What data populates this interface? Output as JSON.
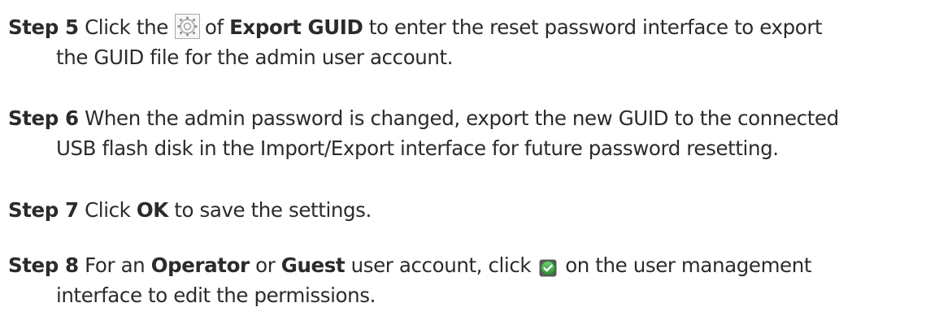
{
  "steps": [
    {
      "label": "Step 5",
      "seg1": "Click the",
      "seg2": "of",
      "bold1": "Export GUID",
      "seg3": "to enter the reset password interface to export",
      "line2": "the GUID file for the admin user account.",
      "icon": "gear-settings-icon"
    },
    {
      "label": "Step 6",
      "line1": "When the admin password is changed, export the new GUID to the connected",
      "line2": "USB flash disk in the Import/Export interface for future password resetting."
    },
    {
      "label": "Step 7",
      "seg1": "Click",
      "bold1": "OK",
      "seg2": "to save the settings."
    },
    {
      "label": "Step 8",
      "seg1": "For an",
      "bold1": "Operator",
      "seg2": "or",
      "bold2": "Guest",
      "seg3": "user account, click",
      "seg4": "on the user management",
      "line2": "interface to edit the permissions.",
      "icon": "green-check-icon",
      "icon_color": "#3aa63a"
    }
  ]
}
